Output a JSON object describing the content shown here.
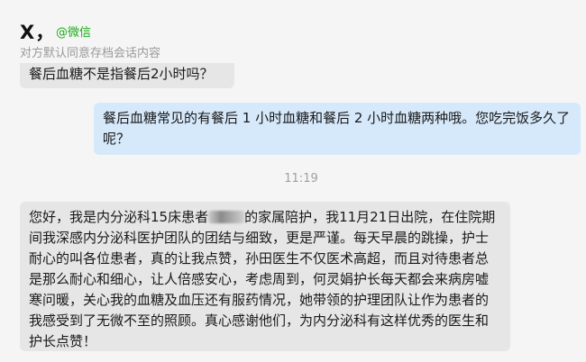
{
  "header": {
    "contact_name": "X，",
    "wechat_tag": "@微信",
    "consent_notice": "对方默认同意存档会话内容"
  },
  "messages": [
    {
      "side": "left",
      "text": "餐后血糖不是指餐后2小时吗？"
    },
    {
      "side": "right",
      "text": "餐后血糖常见的有餐后 1 小时血糖和餐后 2 小时血糖两种哦。您吃完饭多久了呢？"
    },
    {
      "time": "11:19"
    },
    {
      "side": "left",
      "text_before": "您好，我是内分泌科15床患者",
      "text_after": "的家属陪护，我11月21日出院，在住院期间我深感内分泌科医护团队的团结与细致，更是严谨。每天早晨的跳操，护士耐心的叫各位患者，真的让我点赞，孙田医生不仅医术高超，而且对待患者总是那么耐心和细心，让人倍感安心，考虑周到，何灵娟护长每天都会来病房嘘寒问暖，关心我的血糖及血压还有服药情况，她带领的护理团队让作为患者的我感受到了无微不至的照顾。真心感谢他们，为内分泌科有这样优秀的医生和护长点赞！"
    }
  ]
}
